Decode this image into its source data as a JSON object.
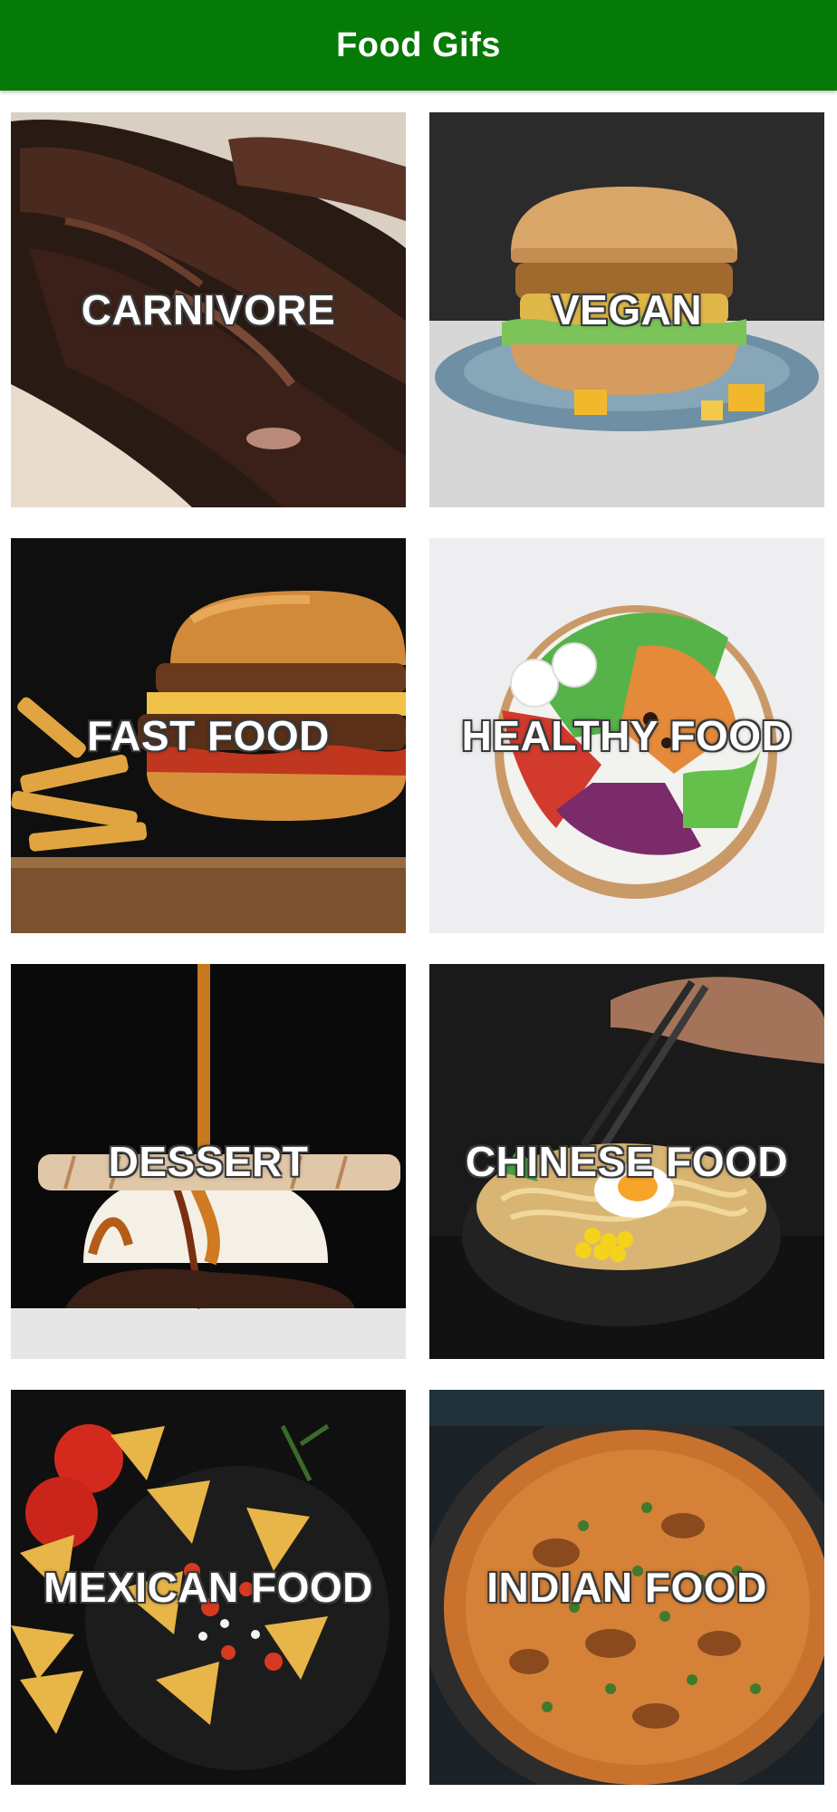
{
  "app_bar": {
    "title": "Food Gifs",
    "color": "#067a06"
  },
  "tiles": [
    {
      "label": "CARNIVORE",
      "image_icon": "grilled-ribs-image"
    },
    {
      "label": "VEGAN",
      "image_icon": "vegan-burger-image"
    },
    {
      "label": "FAST FOOD",
      "image_icon": "burger-fries-image"
    },
    {
      "label": "HEALTHY FOOD",
      "image_icon": "salad-bowl-image"
    },
    {
      "label": "DESSERT",
      "image_icon": "ice-cream-dessert-image"
    },
    {
      "label": "CHINESE FOOD",
      "image_icon": "ramen-bowl-image"
    },
    {
      "label": "MEXICAN FOOD",
      "image_icon": "nachos-image"
    },
    {
      "label": "INDIAN FOOD",
      "image_icon": "curry-pan-image"
    }
  ]
}
